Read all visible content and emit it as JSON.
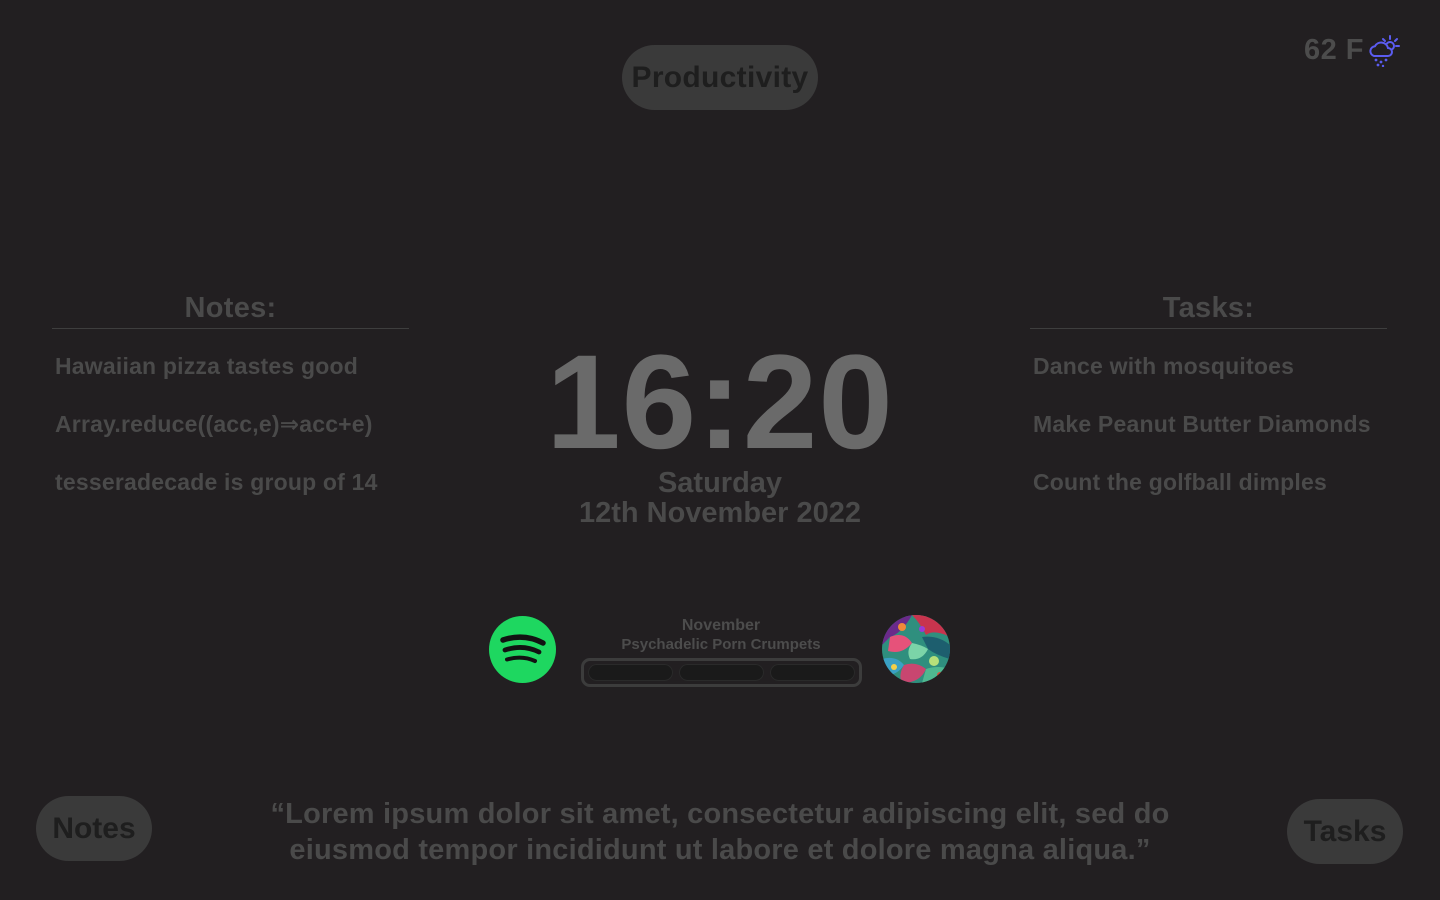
{
  "header": {
    "mode_label": "Productivity"
  },
  "weather": {
    "temperature": "62 F",
    "icon": "cloud-rain-sun-icon",
    "icon_color": "#5b5cf0"
  },
  "notes_panel": {
    "heading": "Notes:",
    "items": [
      "Hawaiian pizza tastes good",
      "Array.reduce((acc,e)⇒acc+e)",
      "tesseradecade is group of 14"
    ]
  },
  "tasks_panel": {
    "heading": "Tasks:",
    "items": [
      "Dance with mosquitoes",
      "Make Peanut Butter Diamonds",
      "Count the golfball dimples"
    ]
  },
  "clock": {
    "time": "16:20",
    "day": "Saturday",
    "date": "12th November 2022"
  },
  "music": {
    "service_icon": "spotify-icon",
    "service_color": "#1ed760",
    "track_title": "November",
    "artist": "Psychadelic Porn Crumpets",
    "controls": [
      "previous",
      "play-pause",
      "next"
    ],
    "album_art_icon": "album-art"
  },
  "quote": {
    "text": "“Lorem ipsum dolor sit amet, consectetur adipiscing elit, sed do eiusmod tempor incididunt ut labore et dolore magna aliqua.”"
  },
  "bottom_buttons": {
    "notes_label": "Notes",
    "tasks_label": "Tasks"
  }
}
